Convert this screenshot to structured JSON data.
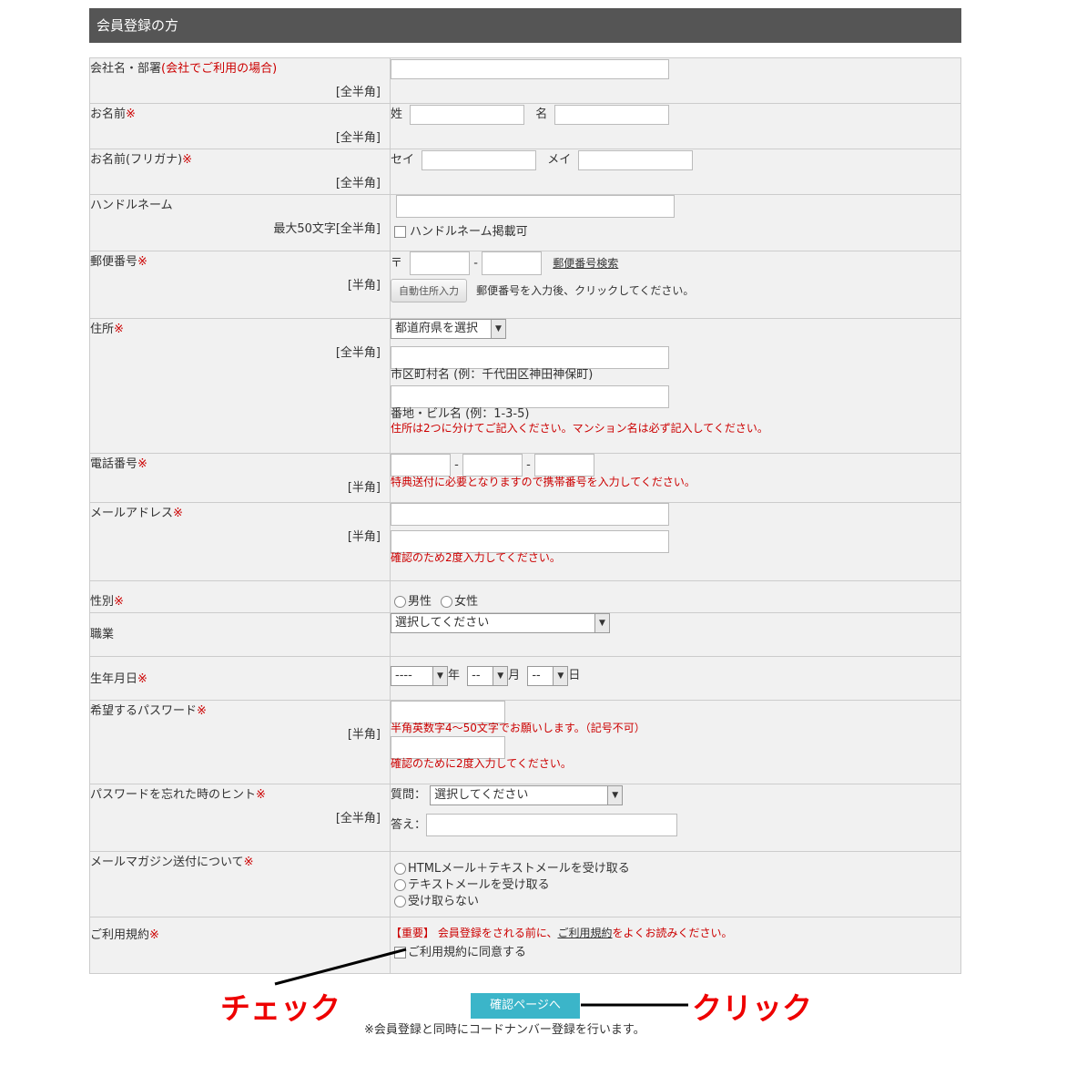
{
  "header": {
    "title": "会員登録の方"
  },
  "rows": {
    "company": {
      "label": "会社名・部署",
      "sub": "(会社でご利用の場合)",
      "note": "[全半角]"
    },
    "name": {
      "label": "お名前",
      "req": "※",
      "note": "[全半角]",
      "sei": "姓",
      "mei": "名"
    },
    "kana": {
      "label": "お名前(フリガナ)",
      "req": "※",
      "note": "[全半角]",
      "sei": "セイ",
      "mei": "メイ"
    },
    "handle": {
      "label": "ハンドルネーム",
      "note": "最大50文字[全半角]",
      "checkbox": "ハンドルネーム掲載可"
    },
    "zip": {
      "label": "郵便番号",
      "req": "※",
      "note": "[半角]",
      "mark": "〒",
      "dash": "-",
      "search_link": "郵便番号検索",
      "auto_button": "自動住所入力",
      "hint": "郵便番号を入力後、クリックしてください。"
    },
    "address": {
      "label": "住所",
      "req": "※",
      "note": "[全半角]",
      "pref_select": "都道府県を選択",
      "city_hint": "市区町村名 (例：千代田区神田神保町)",
      "street_hint": "番地・ビル名 (例：1-3-5)",
      "warning": "住所は2つに分けてご記入ください。マンション名は必ず記入してください。"
    },
    "phone": {
      "label": "電話番号",
      "req": "※",
      "note": "[半角]",
      "dash": "-",
      "warning": "特典送付に必要となりますので携帯番号を入力してください。"
    },
    "email": {
      "label": "メールアドレス",
      "req": "※",
      "note": "[半角]",
      "warning": "確認のため2度入力してください。"
    },
    "gender": {
      "label": "性別",
      "req": "※",
      "male": "男性",
      "female": "女性"
    },
    "job": {
      "label": "職業",
      "select": "選択してください"
    },
    "birth": {
      "label": "生年月日",
      "req": "※",
      "year_val": "----",
      "year": "年",
      "month_val": "--",
      "month": "月",
      "day_val": "--",
      "day": "日"
    },
    "password": {
      "label": "希望するパスワード",
      "req": "※",
      "note": "[半角]",
      "warning1": "半角英数字4～50文字でお願いします。（記号不可）",
      "warning2": "確認のために2度入力してください。"
    },
    "hint": {
      "label": "パスワードを忘れた時のヒント",
      "req": "※",
      "note": "[全半角]",
      "question_label": "質問：",
      "question_select": "選択してください",
      "answer_label": "答え："
    },
    "magazine": {
      "label": "メールマガジン送付について",
      "req": "※",
      "opt1": "HTMLメール＋テキストメールを受け取る",
      "opt2": "テキストメールを受け取る",
      "opt3": "受け取らない"
    },
    "terms": {
      "label": "ご利用規約",
      "req": "※",
      "important": "【重要】",
      "text_before": " 会員登録をされる前に、",
      "link": "ご利用規約",
      "text_after": "をよくお読みください。",
      "agree": "ご利用規約に同意する"
    }
  },
  "submit": {
    "label": "確認ページへ"
  },
  "footnote": "※会員登録と同時にコードナンバー登録を行います。",
  "annotations": {
    "check": "チェック",
    "click": "クリック"
  },
  "colors": {
    "header_bg": "#555555",
    "required": "#cc0000",
    "submit_bg": "#3bb5c9",
    "annotation": "#ee0000"
  }
}
